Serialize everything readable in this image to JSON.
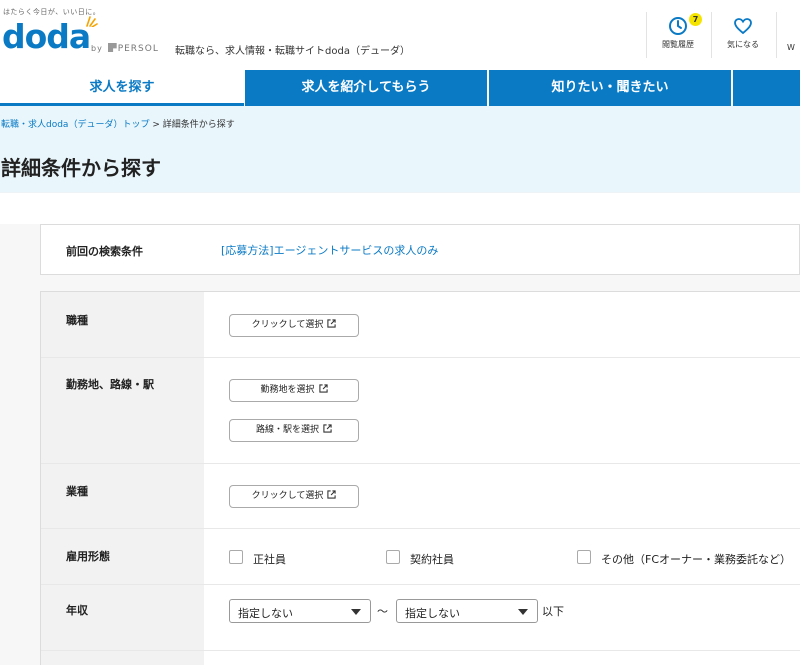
{
  "header": {
    "tagline": "はたらく今日が、いい日に。",
    "logo": "doda",
    "byline_by": "by",
    "byline_brand": "PERSOL",
    "site_desc": "転職なら、求人情報・転職サイトdoda（デューダ）",
    "history": {
      "label": "閲覧履歴",
      "badge": "7",
      "icon": "clock-icon"
    },
    "favorite": {
      "label": "気になる",
      "icon": "heart-icon"
    },
    "cut_label": "W"
  },
  "nav": {
    "tabs": [
      {
        "label": "求人を探す",
        "active": true
      },
      {
        "label": "求人を紹介してもらう",
        "active": false
      },
      {
        "label": "知りたい・聞きたい",
        "active": false
      }
    ]
  },
  "breadcrumb": {
    "home": "転職・求人doda（デューダ）トップ",
    "separator": ">",
    "current": "詳細条件から探す"
  },
  "page_title": "詳細条件から探す",
  "previous_search": {
    "label": "前回の検索条件",
    "value": "[応募方法]エージェントサービスの求人のみ"
  },
  "form": {
    "job_type": {
      "label": "職種",
      "button": "クリックして選択"
    },
    "location": {
      "label": "勤務地、路線・駅",
      "area_button": "勤務地を選択",
      "route_button": "路線・駅を選択"
    },
    "industry": {
      "label": "業種",
      "button": "クリックして選択"
    },
    "employment": {
      "label": "雇用形態",
      "options": [
        "正社員",
        "契約社員",
        "その他（FCオーナー・業務委託など）"
      ]
    },
    "salary": {
      "label": "年収",
      "min": "指定しない",
      "tilde": "〜",
      "max": "指定しない",
      "suffix": "以下"
    }
  },
  "colors": {
    "brand": "#0a7ac5",
    "band": "#e9f6fc",
    "badge": "#f5e400"
  }
}
